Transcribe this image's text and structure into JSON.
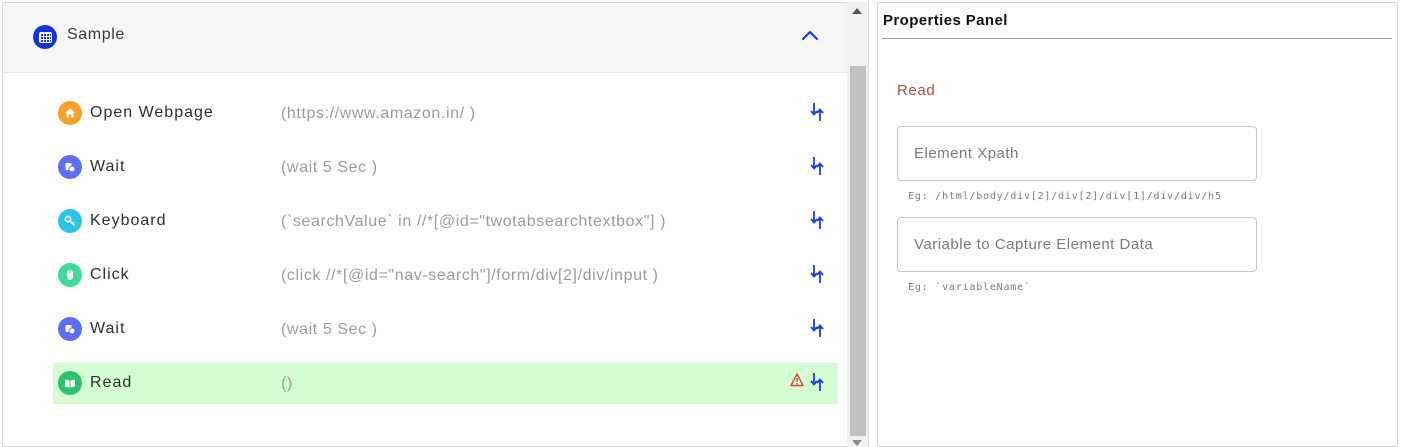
{
  "workflow": {
    "title": "Sample",
    "steps": [
      {
        "name": "Open Webpage",
        "param": "(https://www.amazon.in/ )",
        "icon": "home-icon",
        "color": "#f7a12a"
      },
      {
        "name": "Wait",
        "param": "(wait 5 Sec )",
        "icon": "timer-icon",
        "color": "#5d6ff0"
      },
      {
        "name": "Keyboard",
        "param": "(`searchValue` in //*[@id=\"twotabsearchtextbox\"] )",
        "icon": "key-icon",
        "color": "#2ec4e8"
      },
      {
        "name": "Click",
        "param": "(click //*[@id=\"nav-search\"]/form/div[2]/div/input )",
        "icon": "mouse-icon",
        "color": "#3ddc9a"
      },
      {
        "name": "Wait",
        "param": "(wait 5 Sec )",
        "icon": "timer-icon",
        "color": "#5d6ff0"
      },
      {
        "name": "Read",
        "param": "()",
        "icon": "book-icon",
        "color": "#2bc46e",
        "active": true,
        "warning": true
      }
    ]
  },
  "properties": {
    "title": "Properties Panel",
    "section": "Read",
    "xpath_field": {
      "placeholder": "Element Xpath",
      "hint": "Eg: /html/body/div[2]/div[2]/div[1]/div/div/h5"
    },
    "variable_field": {
      "placeholder": "Variable to Capture Element Data",
      "hint": "Eg: `variableName`"
    }
  },
  "colors": {
    "accent": "#1633d6",
    "active_row": "#d4fdd4",
    "section_label": "#a0524d",
    "warning": "#e0433a"
  }
}
